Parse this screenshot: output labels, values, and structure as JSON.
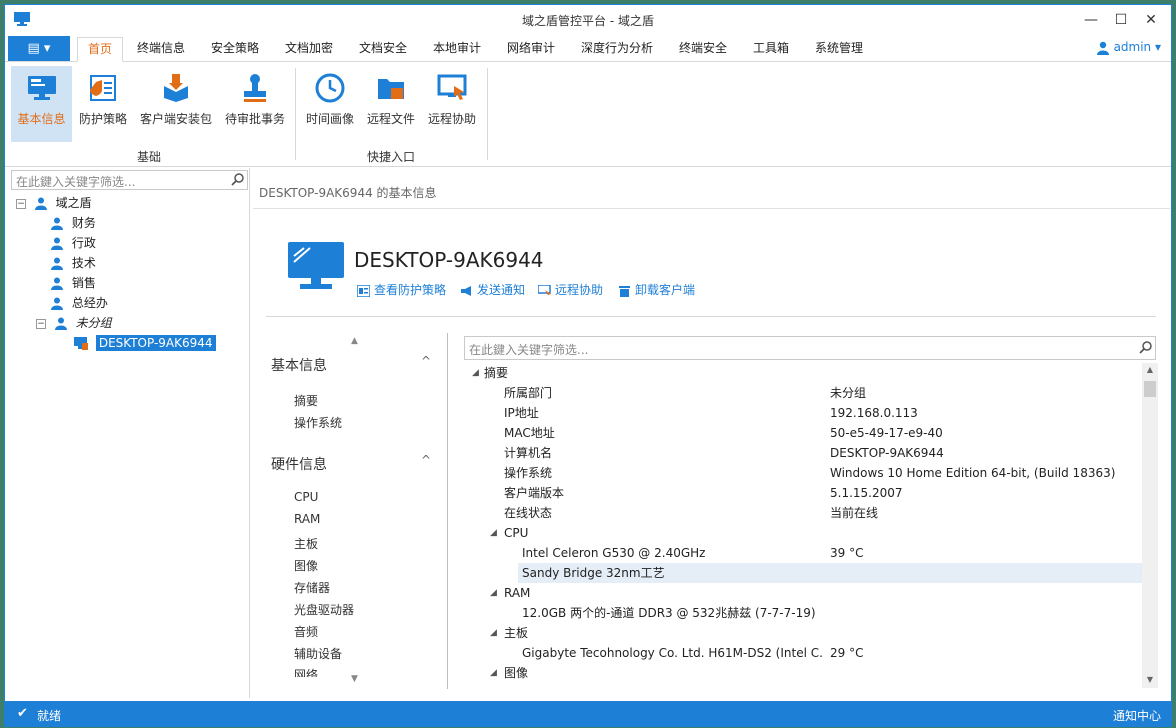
{
  "window": {
    "title": "域之盾管控平台 - 域之盾",
    "controls": [
      "—",
      "☐",
      "✕"
    ]
  },
  "menu": {
    "app_button": "▤ ▾",
    "tabs": [
      "首页",
      "终端信息",
      "安全策略",
      "文档加密",
      "文档安全",
      "本地审计",
      "网络审计",
      "深度行为分析",
      "终端安全",
      "工具箱",
      "系统管理"
    ],
    "active_tab": "首页",
    "user": "admin ▾"
  },
  "ribbon": {
    "groups": [
      {
        "label": "基础",
        "buttons": [
          "基本信息",
          "防护策略",
          "客户端安装包",
          "待审批事务"
        ]
      },
      {
        "label": "快捷入口",
        "buttons": [
          "时间画像",
          "远程文件",
          "远程协助"
        ]
      }
    ],
    "active_button": "基本信息"
  },
  "tree": {
    "filter_placeholder": "在此鍵入关键字筛选...",
    "nodes": [
      {
        "label": "域之盾",
        "expander": "−",
        "level": 0
      },
      {
        "label": "财务",
        "level": 1
      },
      {
        "label": "行政",
        "level": 1
      },
      {
        "label": "技术",
        "level": 1
      },
      {
        "label": "销售",
        "level": 1
      },
      {
        "label": "总经办",
        "level": 1
      },
      {
        "label": "未分组",
        "expander": "−",
        "level": 1
      },
      {
        "label": "DESKTOP-9AK6944",
        "level": 2,
        "selected": true
      }
    ]
  },
  "content": {
    "breadcrumb": "DESKTOP-9AK6944 的基本信息",
    "hostname": "DESKTOP-9AK6944",
    "actions": [
      "查看防护策略",
      "发送通知",
      "远程协助",
      "卸载客户端"
    ]
  },
  "nav": {
    "sections": [
      {
        "title": "基本信息",
        "chevron": "^",
        "items": [
          "摘要",
          "操作系统"
        ]
      },
      {
        "title": "硬件信息",
        "chevron": "^",
        "items": [
          "CPU",
          "RAM",
          "主板",
          "图像",
          "存储器",
          "光盘驱动器",
          "音频",
          "辅助设备",
          "网络"
        ]
      }
    ],
    "scroll_up": "▲",
    "scroll_down": "▼"
  },
  "props": {
    "filter_placeholder": "在此鍵入关键字筛选...",
    "rows": [
      {
        "indent": 0,
        "tri": "◢",
        "name": "摘要",
        "value": ""
      },
      {
        "indent": 1,
        "name": "所属部门",
        "value": "未分组"
      },
      {
        "indent": 1,
        "name": "IP地址",
        "value": "192.168.0.113"
      },
      {
        "indent": 1,
        "name": "MAC地址",
        "value": "50-e5-49-17-e9-40"
      },
      {
        "indent": 1,
        "name": "计算机名",
        "value": "DESKTOP-9AK6944"
      },
      {
        "indent": 1,
        "name": "操作系统",
        "value": "Windows 10 Home Edition 64-bit, (Build 18363)"
      },
      {
        "indent": 1,
        "name": "客户端版本",
        "value": "5.1.15.2007"
      },
      {
        "indent": 1,
        "name": "在线状态",
        "value": "当前在线"
      },
      {
        "indent": 1,
        "tri": "◢",
        "name": "CPU",
        "value": ""
      },
      {
        "indent": 2,
        "name": "Intel Celeron G530 @ 2.40GHz",
        "value": "39 °C"
      },
      {
        "indent": 2,
        "name": "Sandy Bridge 32nm工艺",
        "value": "",
        "selected": true
      },
      {
        "indent": 1,
        "tri": "◢",
        "name": "RAM",
        "value": ""
      },
      {
        "indent": 2,
        "name": "12.0GB 两个的-通道 DDR3 @ 532兆赫兹 (7-7-7-19)",
        "value": ""
      },
      {
        "indent": 1,
        "tri": "◢",
        "name": "主板",
        "value": ""
      },
      {
        "indent": 2,
        "name": "Gigabyte Tecohnology Co. Ltd. H61M-DS2 (Intel C...",
        "value": "29 °C"
      },
      {
        "indent": 1,
        "tri": "◢",
        "name": "图像",
        "value": ""
      }
    ]
  },
  "status": {
    "icon": "✔",
    "text": "就绪",
    "notifications": "通知中心"
  },
  "colors": {
    "accent": "#1d7fd6",
    "active_tab": "#e26d17",
    "ribbon_active_bg": "#cfe3f5"
  }
}
